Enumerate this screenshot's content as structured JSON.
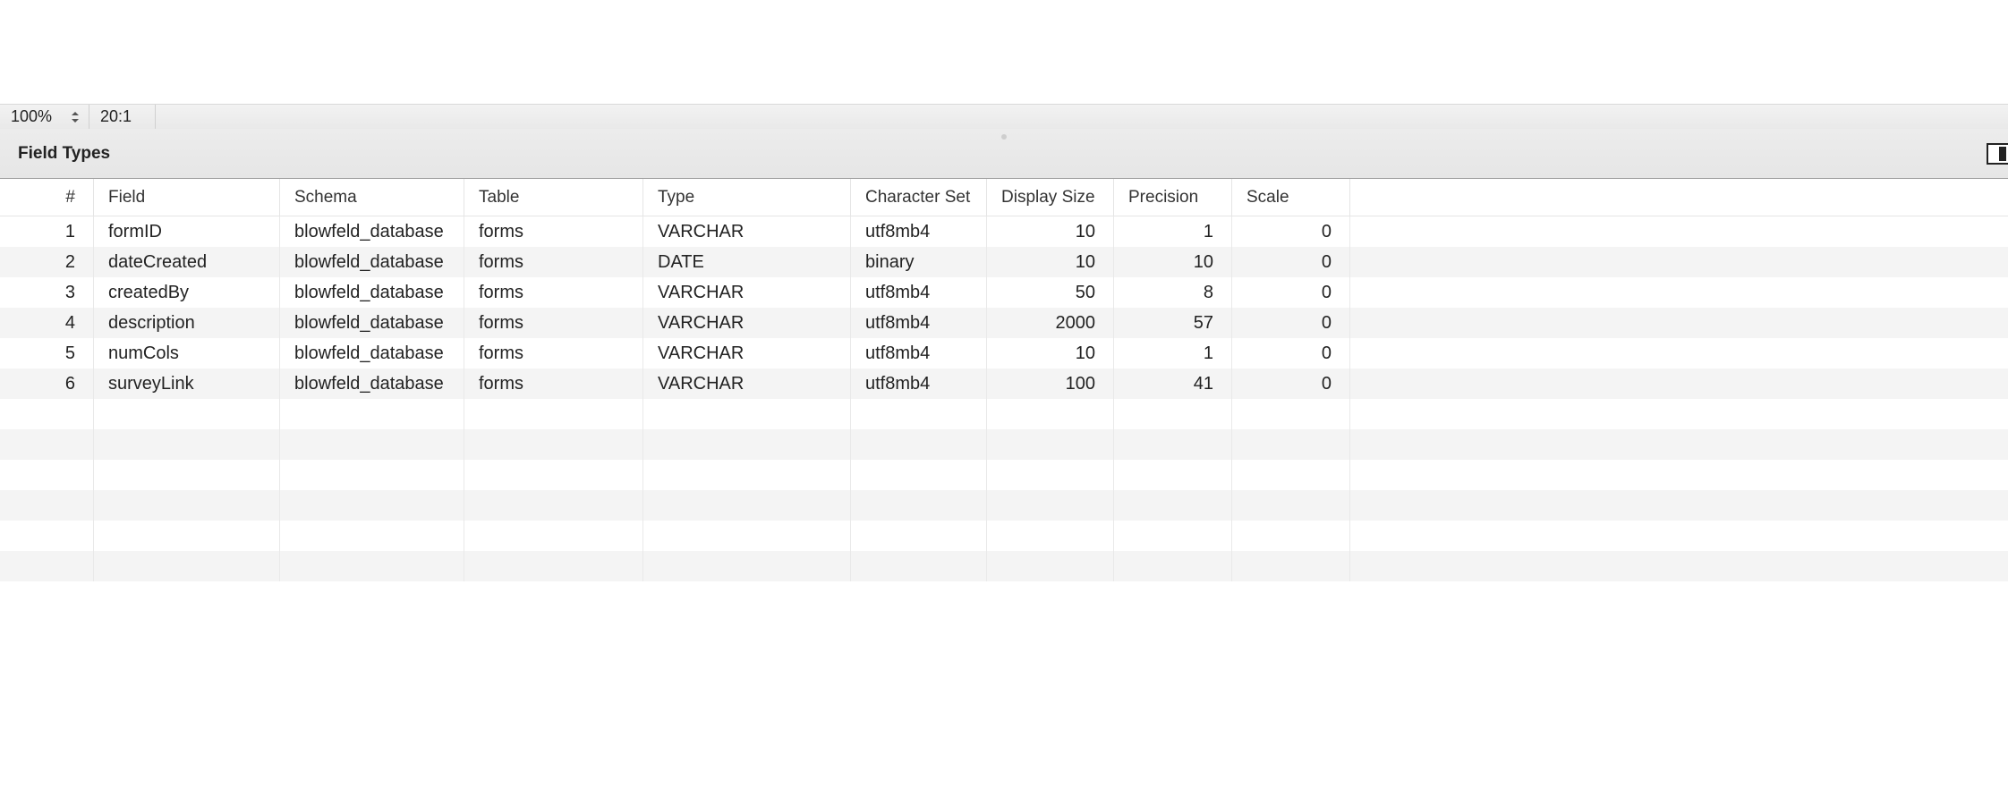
{
  "statusbar": {
    "zoom": "100%",
    "cursor": "20:1"
  },
  "panel": {
    "title": "Field Types"
  },
  "columns": {
    "idx": "#",
    "field": "Field",
    "schema": "Schema",
    "table": "Table",
    "type": "Type",
    "character_set": "Character Set",
    "display_size": "Display Size",
    "precision": "Precision",
    "scale": "Scale"
  },
  "rows": [
    {
      "idx": "1",
      "field": "formID",
      "schema": "blowfeld_database",
      "table": "forms",
      "type": "VARCHAR",
      "character_set": "utf8mb4",
      "display_size": "10",
      "precision": "1",
      "scale": "0"
    },
    {
      "idx": "2",
      "field": "dateCreated",
      "schema": "blowfeld_database",
      "table": "forms",
      "type": "DATE",
      "character_set": "binary",
      "display_size": "10",
      "precision": "10",
      "scale": "0"
    },
    {
      "idx": "3",
      "field": "createdBy",
      "schema": "blowfeld_database",
      "table": "forms",
      "type": "VARCHAR",
      "character_set": "utf8mb4",
      "display_size": "50",
      "precision": "8",
      "scale": "0"
    },
    {
      "idx": "4",
      "field": "description",
      "schema": "blowfeld_database",
      "table": "forms",
      "type": "VARCHAR",
      "character_set": "utf8mb4",
      "display_size": "2000",
      "precision": "57",
      "scale": "0"
    },
    {
      "idx": "5",
      "field": "numCols",
      "schema": "blowfeld_database",
      "table": "forms",
      "type": "VARCHAR",
      "character_set": "utf8mb4",
      "display_size": "10",
      "precision": "1",
      "scale": "0"
    },
    {
      "idx": "6",
      "field": "surveyLink",
      "schema": "blowfeld_database",
      "table": "forms",
      "type": "VARCHAR",
      "character_set": "utf8mb4",
      "display_size": "100",
      "precision": "41",
      "scale": "0"
    }
  ],
  "empty_rows": 6
}
